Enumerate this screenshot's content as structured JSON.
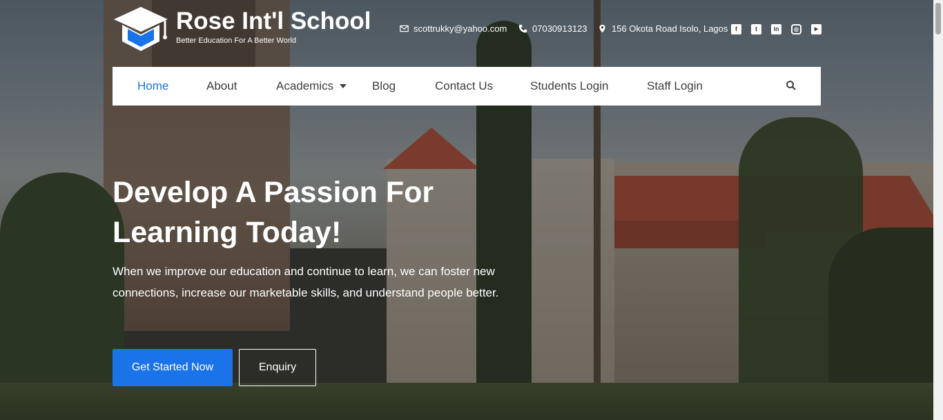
{
  "brand": {
    "name": "Rose Int'l School",
    "tagline": "Better Education For A Better World",
    "logo_icon": "graduation-cap-icon"
  },
  "contact": {
    "email": "scottrukky@yahoo.com",
    "phone": "07030913123",
    "address": "156 Okota Road Isolo, Lagos"
  },
  "socials": [
    {
      "icon": "facebook-icon",
      "glyph": "f"
    },
    {
      "icon": "twitter-icon",
      "glyph": "t"
    },
    {
      "icon": "linkedin-icon",
      "glyph": "in"
    },
    {
      "icon": "instagram-icon",
      "glyph": "◎"
    },
    {
      "icon": "youtube-icon",
      "glyph": "▶"
    }
  ],
  "nav": {
    "items": [
      {
        "label": "Home",
        "active": true
      },
      {
        "label": "About"
      },
      {
        "label": "Academics",
        "has_dropdown": true
      },
      {
        "label": "Blog"
      },
      {
        "label": "Contact Us"
      },
      {
        "label": "Students Login"
      },
      {
        "label": "Staff Login"
      }
    ],
    "search_icon": "search-icon"
  },
  "hero": {
    "title_line1": "Develop A Passion For",
    "title_line2": "Learning Today!",
    "text": "When we improve our education and continue to learn, we can foster new connections, increase our marketable skills, and understand people better.",
    "primary_button": "Get Started Now",
    "secondary_button": "Enquiry"
  },
  "colors": {
    "accent": "#1a73e8",
    "nav_active": "#1a73d8",
    "nav_text": "#3d3d3d"
  }
}
